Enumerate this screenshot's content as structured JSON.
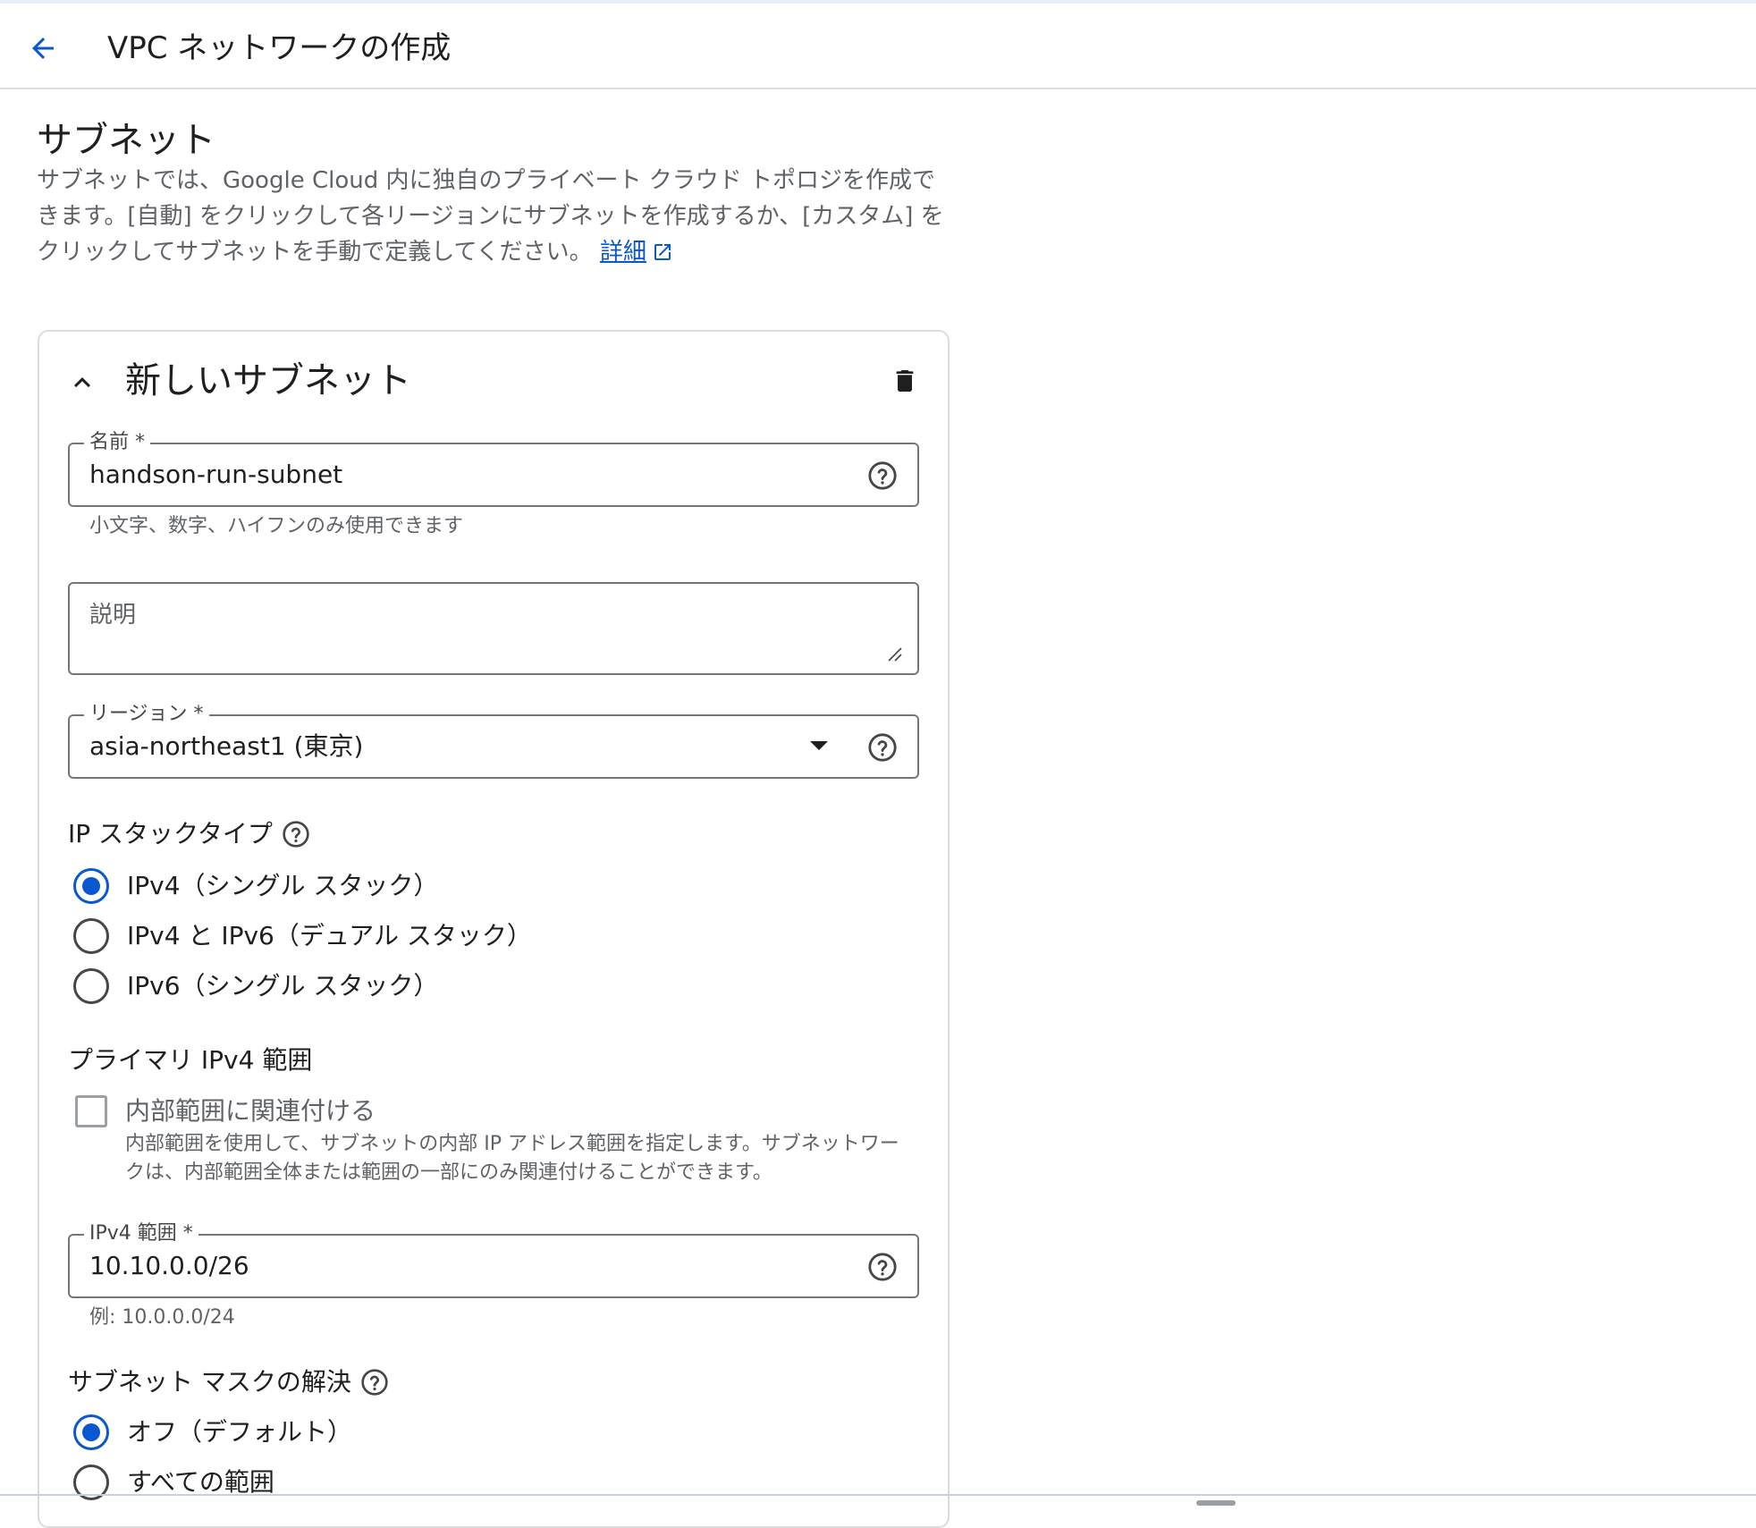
{
  "header": {
    "title": "VPC ネットワークの作成"
  },
  "section": {
    "title": "サブネット",
    "description": "サブネットでは、Google Cloud 内に独自のプライベート クラウド トポロジを作成できます。[自動] をクリックして各リージョンにサブネットを作成するか、[カスタム] をクリックしてサブネットを手動で定義してください。",
    "link_label": "詳細"
  },
  "subnet_card": {
    "title": "新しいサブネット",
    "name_field": {
      "label": "名前 *",
      "value": "handson-run-subnet",
      "hint": "小文字、数字、ハイフンのみ使用できます"
    },
    "description_field": {
      "placeholder": "説明"
    },
    "region_field": {
      "label": "リージョン *",
      "value": "asia-northeast1 (東京)"
    },
    "ip_stack": {
      "label": "IP スタックタイプ",
      "options": [
        {
          "label": "IPv4（シングル スタック）",
          "selected": true
        },
        {
          "label": "IPv4 と IPv6（デュアル スタック）",
          "selected": false
        },
        {
          "label": "IPv6（シングル スタック）",
          "selected": false
        }
      ]
    },
    "primary_ipv4": {
      "label": "プライマリ IPv4 範囲",
      "checkbox_label": "内部範囲に関連付ける",
      "checkbox_checked": false,
      "checkbox_desc": "内部範囲を使用して、サブネットの内部 IP アドレス範囲を指定します。サブネットワークは、内部範囲全体または範囲の一部にのみ関連付けることができます。"
    },
    "ipv4_range_field": {
      "label": "IPv4 範囲 *",
      "value": "10.10.0.0/26",
      "hint": "例: 10.0.0.0/24"
    },
    "mask_resolution": {
      "label": "サブネット マスクの解決",
      "options": [
        {
          "label": "オフ（デフォルト）",
          "selected": true
        },
        {
          "label": "すべての範囲",
          "selected": false
        }
      ]
    }
  },
  "icons": {
    "back": "arrow-back-icon",
    "collapse": "chevron-up-icon",
    "delete": "trash-icon",
    "help": "help-circle-icon",
    "dropdown": "caret-down-icon",
    "external": "external-link-icon"
  },
  "colors": {
    "accent": "#0b57d0",
    "text": "#1f1f1f",
    "secondary_text": "#5f6368",
    "border": "#747775"
  }
}
